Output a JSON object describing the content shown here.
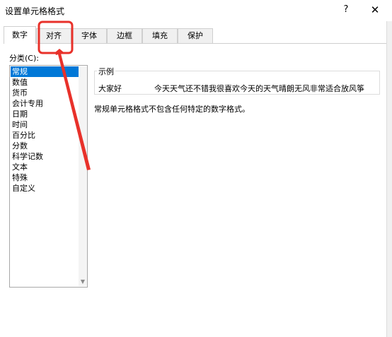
{
  "window": {
    "title": "设置单元格格式",
    "help": "?",
    "close": "✕"
  },
  "tabs": [
    {
      "label": "数字",
      "active": true
    },
    {
      "label": "对齐"
    },
    {
      "label": "字体"
    },
    {
      "label": "边框"
    },
    {
      "label": "填充"
    },
    {
      "label": "保护"
    }
  ],
  "category": {
    "label": "分类(C):",
    "items": [
      "常规",
      "数值",
      "货币",
      "会计专用",
      "日期",
      "时间",
      "百分比",
      "分数",
      "科学记数",
      "文本",
      "特殊",
      "自定义"
    ],
    "selected": "常规"
  },
  "sample": {
    "legend": "示例",
    "value": "大家好",
    "preview": "今天天气还不错我很喜欢今天的天气晴朗无风非常适合放风筝"
  },
  "description": "常规单元格格式不包含任何特定的数字格式。",
  "colors": {
    "selection": "#0078d7",
    "annotation": "#e8312a"
  }
}
